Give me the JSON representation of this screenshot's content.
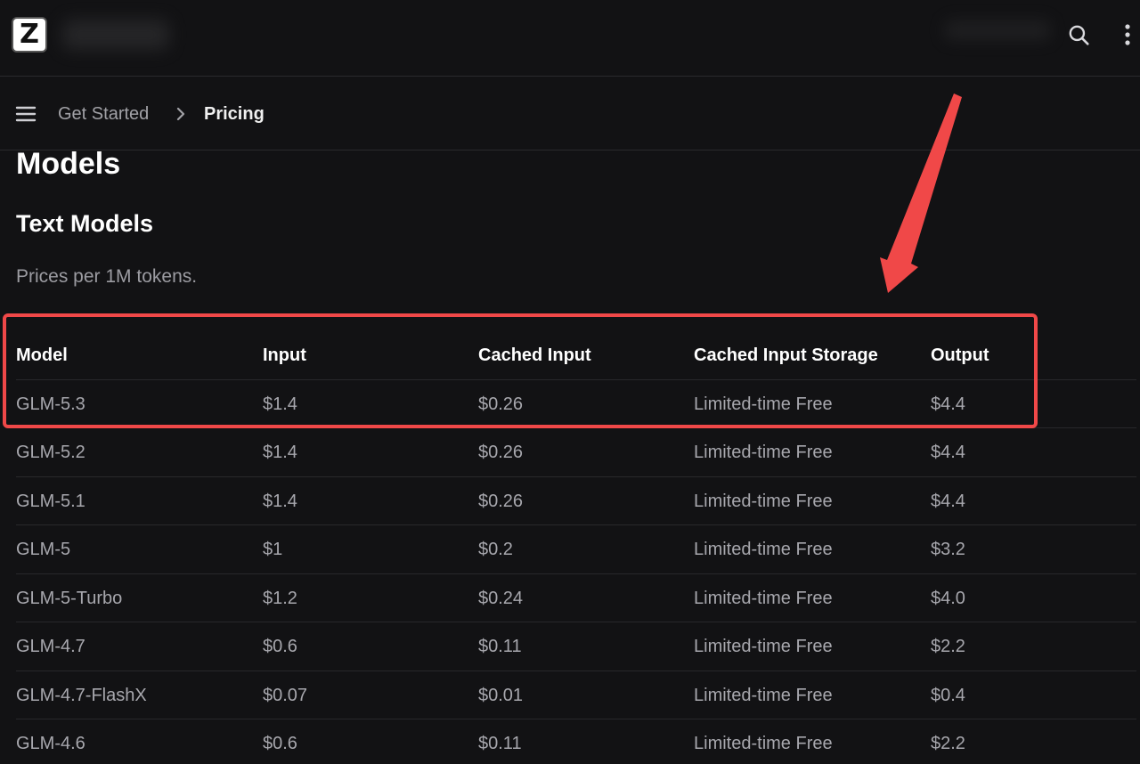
{
  "topbar": {
    "logo_text": "Z",
    "icons": [
      "search-icon",
      "more-vertical-icon"
    ]
  },
  "breadcrumb": {
    "items": [
      "Get Started",
      "Pricing"
    ]
  },
  "content": {
    "heading": "Models",
    "subheading": "Text Models",
    "description": "Prices per 1M tokens."
  },
  "table": {
    "headers": [
      "Model",
      "Input",
      "Cached Input",
      "Cached Input Storage",
      "Output"
    ],
    "rows": [
      [
        "GLM-5.3",
        "$1.4",
        "$0.26",
        "Limited-time Free",
        "$4.4"
      ],
      [
        "GLM-5.2",
        "$1.4",
        "$0.26",
        "Limited-time Free",
        "$4.4"
      ],
      [
        "GLM-5.1",
        "$1.4",
        "$0.26",
        "Limited-time Free",
        "$4.4"
      ],
      [
        "GLM-5",
        "$1",
        "$0.2",
        "Limited-time Free",
        "$3.2"
      ],
      [
        "GLM-5-Turbo",
        "$1.2",
        "$0.24",
        "Limited-time Free",
        "$4.0"
      ],
      [
        "GLM-4.7",
        "$0.6",
        "$0.11",
        "Limited-time Free",
        "$2.2"
      ],
      [
        "GLM-4.7-FlashX",
        "$0.07",
        "$0.01",
        "Limited-time Free",
        "$0.4"
      ],
      [
        "GLM-4.6",
        "$0.6",
        "$0.11",
        "Limited-time Free",
        "$2.2"
      ]
    ]
  },
  "colors": {
    "background": "#121214",
    "annotation": "#f04848",
    "muted_text": "#a7a7ad"
  }
}
